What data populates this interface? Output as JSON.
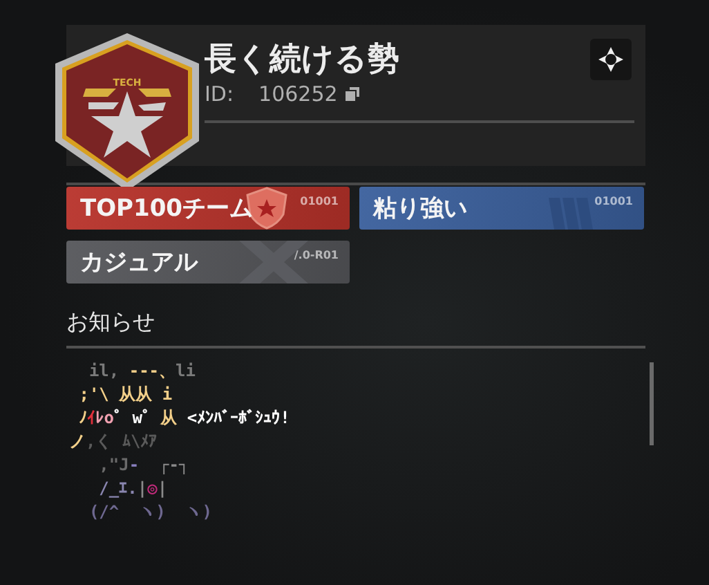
{
  "profile": {
    "emblem_text": "TECH",
    "name": "長く続ける勢",
    "id_label": "ID:",
    "id_value": "106252"
  },
  "tags": [
    {
      "label": "TOP100チーム",
      "code": "01001",
      "color": "#b8322a",
      "kind": "shield"
    },
    {
      "label": "粘り強い",
      "code": "01001",
      "color": "#3a5f9c",
      "kind": "stripes"
    },
    {
      "label": "カジュアル",
      "code": "/.0-R01",
      "color": "#55565a",
      "kind": "cross"
    }
  ],
  "notice": {
    "title": "お知らせ",
    "art": [
      [
        {
          "text": "  il, ",
          "color": "#7a7a7a"
        },
        {
          "text": "‐‐‐、",
          "color": "#f3d08a"
        },
        {
          "text": "li",
          "color": "#7a7a7a"
        }
      ],
      [
        {
          "text": " ;'\\ 从从 i",
          "color": "#f3d08a"
        }
      ],
      [
        {
          "text": " ﾉ",
          "color": "#f3d08a"
        },
        {
          "text": "ｲ",
          "color": "#e0303c"
        },
        {
          "text": "ﾚo",
          "color": "#f0a0b0"
        },
        {
          "text": "ﾟ wﾟ ",
          "color": "#ffffff"
        },
        {
          "text": "从",
          "color": "#f3d08a"
        },
        {
          "text": " <ﾒﾝﾊﾞｰﾎﾞｼｭｳ!",
          "color": "#ffffff"
        }
      ],
      [
        {
          "text": "ノ",
          "color": "#f3d08a"
        },
        {
          "text": ",く ﾑ\\ﾒｱ",
          "color": "#5a5a5a"
        }
      ],
      [
        {
          "text": "   ,\"J",
          "color": "#6a6a6a"
        },
        {
          "text": "‐",
          "color": "#8a80c0"
        },
        {
          "text": "  ┌‐┐",
          "color": "#8a8a8a"
        }
      ],
      [
        {
          "text": "   /_ｴ.",
          "color": "#8a86b0"
        },
        {
          "text": "|",
          "color": "#8a8a8a"
        },
        {
          "text": "◎",
          "color": "#c02a7a"
        },
        {
          "text": "|",
          "color": "#8a8a8a"
        }
      ],
      [
        {
          "text": "  (/^  ヽ)  ヽ)",
          "color": "#6e6890"
        }
      ]
    ]
  }
}
